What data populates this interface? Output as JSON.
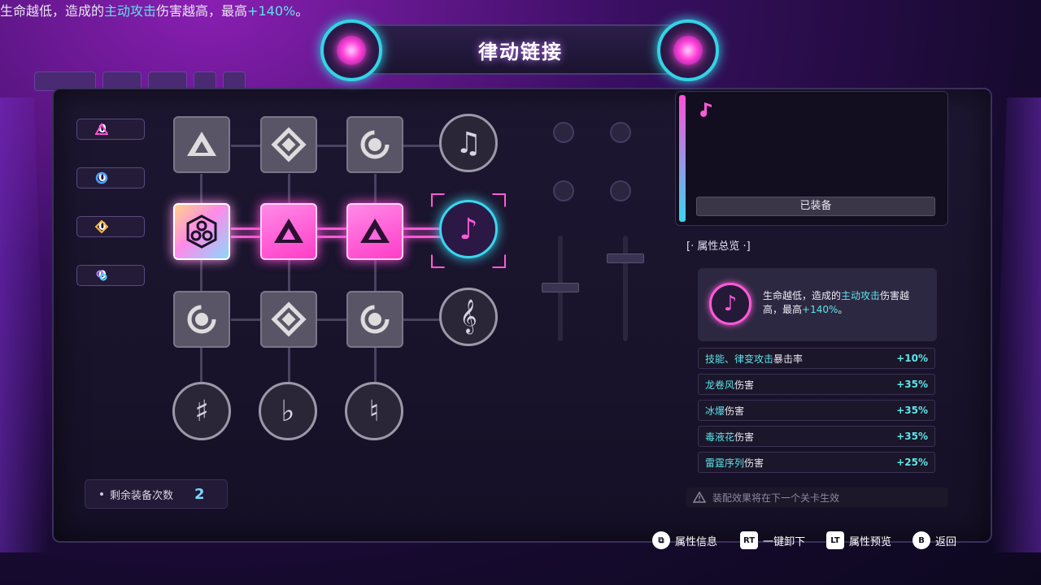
{
  "title": "律动链接",
  "counters": [
    {
      "icon": "triangle-icon",
      "value": "0"
    },
    {
      "icon": "ring-icon",
      "value": "0"
    },
    {
      "icon": "diamond-icon",
      "value": "0"
    },
    {
      "icon": "cluster-icon",
      "value": "0"
    }
  ],
  "remaining": {
    "label": "剩余装备次数",
    "value": "2"
  },
  "detail": {
    "desc_pre": "生命越低，造成的",
    "desc_hl": "主动攻击",
    "desc_mid": "伤害越高，最高",
    "desc_val": "+140%",
    "desc_end": "。",
    "equipped_label": "已装备"
  },
  "summary": {
    "section_title": "[· 属性总览 ·]",
    "desc_pre": "生命越低，造成的",
    "desc_hl": "主动攻击",
    "desc_mid": "伤害越高，最高",
    "desc_val": "+140%",
    "desc_end": "。"
  },
  "stats": [
    {
      "hl": "技能、律变攻击",
      "rest": "暴击率",
      "value": "+10%"
    },
    {
      "hl": "龙卷风",
      "rest": "伤害",
      "value": "+35%"
    },
    {
      "hl": "冰爆",
      "rest": "伤害",
      "value": "+35%"
    },
    {
      "hl": "毒液花",
      "rest": "伤害",
      "value": "+35%"
    },
    {
      "hl": "雷霆序列",
      "rest": "伤害",
      "value": "+25%"
    }
  ],
  "warning": "装配效果将在下一个关卡生效",
  "footer": [
    {
      "key": "⧉",
      "label": "属性信息"
    },
    {
      "key": "RT",
      "label": "一键卸下"
    },
    {
      "key": "LT",
      "label": "属性预览"
    },
    {
      "key": "B",
      "label": "返回"
    }
  ],
  "colors": {
    "accent_pink": "#ff5ad8",
    "accent_cyan": "#3ad6ef",
    "stat_value": "#5ee4e9"
  }
}
